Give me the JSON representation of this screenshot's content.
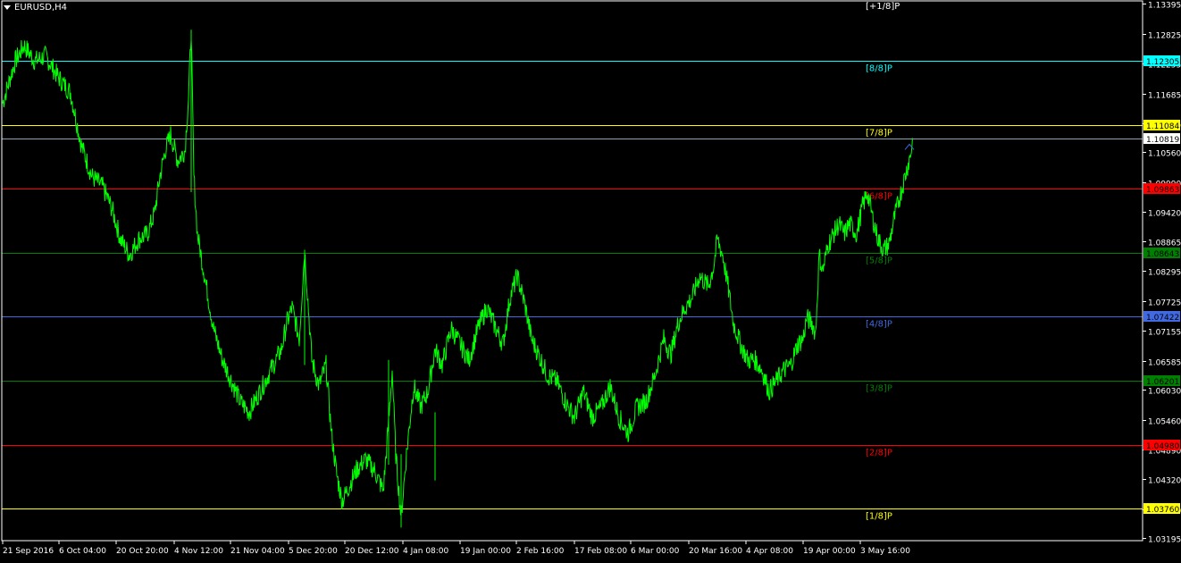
{
  "chart_data": {
    "type": "line",
    "title": "EURUSD,H4",
    "x_labels": [
      "21 Sep 2016",
      "6 Oct 04:00",
      "20 Oct 20:00",
      "4 Nov 12:00",
      "21 Nov 04:00",
      "5 Dec 20:00",
      "20 Dec 12:00",
      "4 Jan 08:00",
      "19 Jan 00:00",
      "2 Feb 16:00",
      "17 Feb 08:00",
      "6 Mar 00:00",
      "20 Mar 16:00",
      "4 Apr 08:00",
      "19 Apr 00:00",
      "3 May 16:00"
    ],
    "y_ticks": [
      "1.13395",
      "1.12825",
      "1.12255",
      "1.11685",
      "1.11115",
      "1.10560",
      "1.09990",
      "1.09420",
      "1.08865",
      "1.08295",
      "1.07725",
      "1.07155",
      "1.06585",
      "1.06030",
      "1.05460",
      "1.04890",
      "1.04320",
      "1.03750",
      "1.03195"
    ],
    "ylim": [
      1.0315,
      1.1345
    ],
    "current_price": "1.10819",
    "series": [
      {
        "color": "#00FF00",
        "x": [
          0,
          14,
          24,
          36,
          48,
          62,
          76,
          88,
          100,
          112,
          122,
          132,
          142,
          152,
          162,
          170,
          176,
          182,
          188,
          196,
          204,
          208,
          211,
          214,
          218,
          226,
          236,
          246,
          256,
          266,
          276,
          288,
          300,
          312,
          318,
          324,
          332,
          338,
          346,
          354,
          362,
          368,
          374,
          380,
          388,
          396,
          406,
          416,
          426,
          432,
          436,
          440,
          446,
          452,
          460,
          468,
          476,
          484,
          492,
          502,
          512,
          522,
          532,
          542,
          552,
          560,
          568,
          576,
          584,
          592,
          600,
          610,
          620,
          630,
          640,
          650,
          660,
          670,
          680,
          690,
          700,
          710,
          720,
          730,
          740,
          748,
          756,
          764,
          772,
          780,
          790,
          796,
          800,
          806,
          812,
          818,
          826,
          834,
          842,
          850,
          858,
          866,
          874,
          882,
          890,
          896,
          900,
          906,
          910,
          914,
          918,
          924,
          930,
          936,
          942,
          948,
          956,
          962,
          968,
          974,
          980,
          986,
          992,
          998,
          1004,
          1010,
          1016,
          1019
        ],
        "y": [
          1.115,
          1.123,
          1.126,
          1.123,
          1.124,
          1.12,
          1.117,
          1.107,
          1.101,
          1.099,
          1.095,
          1.089,
          1.086,
          1.089,
          1.09,
          1.094,
          1.101,
          1.106,
          1.109,
          1.104,
          1.106,
          1.116,
          1.129,
          1.101,
          1.09,
          1.082,
          1.072,
          1.066,
          1.062,
          1.058,
          1.056,
          1.06,
          1.064,
          1.068,
          1.073,
          1.076,
          1.07,
          1.087,
          1.066,
          1.061,
          1.065,
          1.052,
          1.044,
          1.039,
          1.042,
          1.045,
          1.047,
          1.045,
          1.041,
          1.054,
          1.064,
          1.048,
          1.036,
          1.048,
          1.061,
          1.057,
          1.06,
          1.068,
          1.065,
          1.072,
          1.069,
          1.066,
          1.072,
          1.076,
          1.072,
          1.069,
          1.078,
          1.082,
          1.077,
          1.07,
          1.067,
          1.063,
          1.062,
          1.058,
          1.055,
          1.06,
          1.055,
          1.057,
          1.061,
          1.055,
          1.052,
          1.057,
          1.058,
          1.063,
          1.07,
          1.067,
          1.073,
          1.076,
          1.078,
          1.082,
          1.08,
          1.084,
          1.089,
          1.086,
          1.08,
          1.073,
          1.069,
          1.066,
          1.066,
          1.064,
          1.06,
          1.062,
          1.064,
          1.065,
          1.069,
          1.07,
          1.074,
          1.073,
          1.071,
          1.086,
          1.083,
          1.088,
          1.09,
          1.092,
          1.09,
          1.092,
          1.09,
          1.095,
          1.098,
          1.093,
          1.089,
          1.087,
          1.088,
          1.093,
          1.097,
          1.101,
          1.105,
          1.1082
        ]
      }
    ],
    "murrey_levels": [
      {
        "label": "[+1/8]P",
        "price": 1.1345,
        "color": "#FFFFFF",
        "badge": ""
      },
      {
        "label": "[8/8]P",
        "price": 1.12305,
        "color": "#00FFFF",
        "badge": "1.12305",
        "badge_bg": "#00FFFF",
        "badge_fg": "#000000"
      },
      {
        "label": "[7/8]P",
        "price": 1.11084,
        "color": "#FFFF00",
        "badge": "1.11084",
        "badge_bg": "#FFFF00",
        "badge_fg": "#000000"
      },
      {
        "label": "[6/8]P",
        "price": 1.09863,
        "color": "#FF0000",
        "badge": "1.09863",
        "badge_bg": "#FF0000",
        "badge_fg": "#000000"
      },
      {
        "label": "[5/8]P",
        "price": 1.08643,
        "color": "#008000",
        "badge": "1.08643",
        "badge_bg": "#008000",
        "badge_fg": "#000000"
      },
      {
        "label": "[4/8]P",
        "price": 1.07422,
        "color": "#4169E1",
        "badge": "1.07422",
        "badge_bg": "#4169E1",
        "badge_fg": "#000000"
      },
      {
        "label": "[3/8]P",
        "price": 1.06201,
        "color": "#008000",
        "badge": "1.06201",
        "badge_bg": "#008000",
        "badge_fg": "#000000"
      },
      {
        "label": "[2/8]P",
        "price": 1.0498,
        "color": "#FF0000",
        "badge": "1.04980",
        "badge_bg": "#FF0000",
        "badge_fg": "#000000"
      },
      {
        "label": "[1/8]P",
        "price": 1.0376,
        "color": "#FFFF00",
        "badge": "1.03760",
        "badge_bg": "#FFFF00",
        "badge_fg": "#000000"
      }
    ],
    "grid": false,
    "background": "#000000"
  }
}
